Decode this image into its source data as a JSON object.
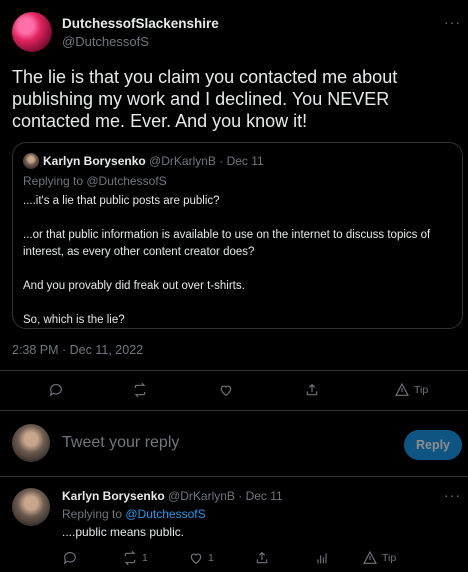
{
  "tweet": {
    "author_name": "DutchessofSlackenshire",
    "author_handle": "@DutchessofS",
    "text": "The lie is that you claim you contacted me about publishing my work and I declined.  You NEVER contacted me.  Ever.  And you know it!",
    "timestamp": "2:38 PM · Dec 11, 2022",
    "more": "···"
  },
  "quote": {
    "author_name": "Karlyn Borysenko",
    "author_handle": "@DrKarlynB",
    "date": "· Dec 11",
    "replying_to": "Replying to @DutchessofS",
    "paragraphs": [
      "....it's a lie that public posts are public?",
      "...or that public information is available to use on the internet to discuss topics of interest, as every other content creator does?",
      "And you provably did freak out over t-shirts.",
      "So, which is the lie?"
    ]
  },
  "actions": {
    "tip_label": "Tip"
  },
  "composer": {
    "placeholder": "Tweet your reply",
    "reply_button": "Reply"
  },
  "reply": {
    "author_name": "Karlyn Borysenko",
    "author_handle": "@DrKarlynB",
    "date": "· Dec 11",
    "replying_prefix": "Replying to ",
    "replying_handle": "@DutchessofS",
    "text": "....public means public.",
    "retweet_count": "1",
    "like_count": "1",
    "tip_label": "Tip",
    "more": "···"
  },
  "colors": {
    "background": "#000000",
    "text": "#e7e9ea",
    "secondary": "#71767b",
    "accent": "#1d9bf0",
    "border": "#2f3336"
  }
}
